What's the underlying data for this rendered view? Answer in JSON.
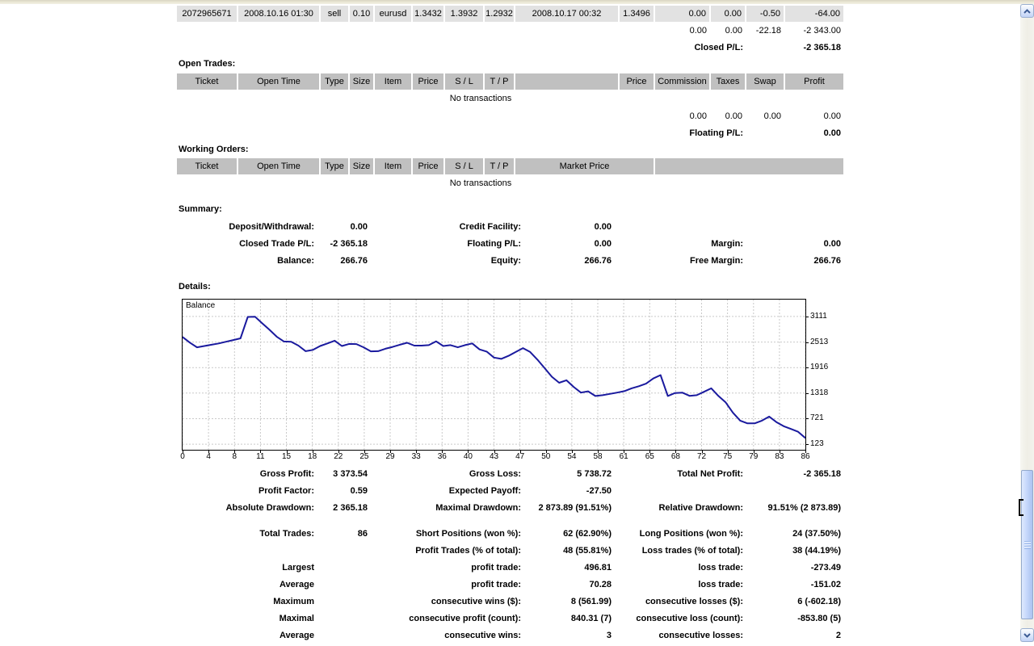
{
  "colors": {
    "table_header_bg": "#c0c0c0",
    "trade_row_bg": "#e2e2e2",
    "chart_line": "#1a1a9e",
    "chart_grid": "#c9c9c9",
    "window_border": "#ece9d8",
    "scrollbar_accent": "#4f6fa8"
  },
  "closed_trades": {
    "row": [
      "2072965671",
      "2008.10.16 01:30",
      "sell",
      "0.10",
      "eurusd",
      "1.3432",
      "1.3932",
      "1.2932",
      "2008.10.17 00:32",
      "1.3496",
      "0.00",
      "0.00",
      "-0.50",
      "-64.00"
    ],
    "totals": [
      "0.00",
      "0.00",
      "-22.18",
      "-2 343.00"
    ],
    "closed_pl_label": "Closed P/L:",
    "closed_pl_value": "-2 365.18"
  },
  "open_trades": {
    "heading": "Open Trades:",
    "headers": [
      "Ticket",
      "Open Time",
      "Type",
      "Size",
      "Item",
      "Price",
      "S / L",
      "T / P",
      "",
      "Price",
      "Commission",
      "Taxes",
      "Swap",
      "Profit"
    ],
    "no_transactions": "No transactions",
    "totals": [
      "0.00",
      "0.00",
      "0.00",
      "0.00"
    ],
    "floating_pl_label": "Floating P/L:",
    "floating_pl_value": "0.00"
  },
  "working_orders": {
    "heading": "Working Orders:",
    "headers": [
      "Ticket",
      "Open Time",
      "Type",
      "Size",
      "Item",
      "Price",
      "S / L",
      "T / P",
      "Market Price",
      ""
    ],
    "no_transactions": "No transactions"
  },
  "summary": {
    "heading": "Summary:",
    "rows": [
      [
        "Deposit/Withdrawal:",
        "0.00",
        "Credit Facility:",
        "0.00",
        "",
        ""
      ],
      [
        "Closed Trade P/L:",
        "-2 365.18",
        "Floating P/L:",
        "0.00",
        "Margin:",
        "0.00"
      ],
      [
        "Balance:",
        "266.76",
        "Equity:",
        "266.76",
        "Free Margin:",
        "266.76"
      ]
    ]
  },
  "details_heading": "Details:",
  "chart_data": {
    "type": "line",
    "title": "Balance",
    "x_ticks": [
      0,
      4,
      8,
      11,
      15,
      18,
      22,
      25,
      29,
      33,
      36,
      40,
      43,
      47,
      50,
      54,
      58,
      61,
      65,
      68,
      72,
      75,
      79,
      83,
      86
    ],
    "y_ticks": [
      3111,
      2513,
      1916,
      1318,
      721,
      123
    ],
    "xlim": [
      0,
      86
    ],
    "ylim": [
      -7,
      3506
    ],
    "grid": true,
    "legend_position": "top-left",
    "series": [
      {
        "name": "Balance",
        "color": "#1a1a9e",
        "values": [
          2632,
          2500,
          2390,
          2420,
          2450,
          2480,
          2520,
          2560,
          2600,
          3100,
          3105,
          2950,
          2800,
          2640,
          2525,
          2520,
          2430,
          2300,
          2330,
          2420,
          2480,
          2545,
          2420,
          2470,
          2465,
          2390,
          2295,
          2300,
          2355,
          2400,
          2450,
          2495,
          2430,
          2430,
          2440,
          2530,
          2420,
          2440,
          2390,
          2440,
          2480,
          2340,
          2290,
          2150,
          2120,
          2190,
          2280,
          2370,
          2280,
          2100,
          1900,
          1700,
          1560,
          1620,
          1465,
          1330,
          1360,
          1250,
          1270,
          1300,
          1330,
          1365,
          1430,
          1480,
          1540,
          1660,
          1740,
          1250,
          1320,
          1330,
          1255,
          1270,
          1350,
          1430,
          1250,
          1100,
          860,
          675,
          610,
          610,
          675,
          770,
          640,
          545,
          480,
          415,
          267
        ]
      }
    ]
  },
  "stats": {
    "rows": [
      [
        "Gross Profit:",
        "3 373.54",
        "Gross Loss:",
        "5 738.72",
        "Total Net Profit:",
        "-2 365.18"
      ],
      [
        "Profit Factor:",
        "0.59",
        "Expected Payoff:",
        "-27.50",
        "",
        ""
      ],
      [
        "Absolute Drawdown:",
        "2 365.18",
        "Maximal Drawdown:",
        "2 873.89 (91.51%)",
        "Relative Drawdown:",
        "91.51% (2 873.89)"
      ],
      [
        "Total Trades:",
        "86",
        "Short Positions (won %):",
        "62 (62.90%)",
        "Long Positions (won %):",
        "24 (37.50%)"
      ],
      [
        "",
        "",
        "Profit Trades (% of total):",
        "48 (55.81%)",
        "Loss trades (% of total):",
        "38 (44.19%)"
      ],
      [
        "Largest",
        "",
        "profit trade:",
        "496.81",
        "loss trade:",
        "-273.49"
      ],
      [
        "Average",
        "",
        "profit trade:",
        "70.28",
        "loss trade:",
        "-151.02"
      ],
      [
        "Maximum",
        "",
        "consecutive wins ($):",
        "8 (561.99)",
        "consecutive losses ($):",
        "6 (-602.18)"
      ],
      [
        "Maximal",
        "",
        "consecutive profit (count):",
        "840.31 (7)",
        "consecutive loss (count):",
        "-853.80 (5)"
      ],
      [
        "Average",
        "",
        "consecutive wins:",
        "3",
        "consecutive losses:",
        "2"
      ]
    ]
  },
  "scrollbar": {
    "up_icon": "chevron-up-icon",
    "down_icon": "chevron-down-icon"
  }
}
